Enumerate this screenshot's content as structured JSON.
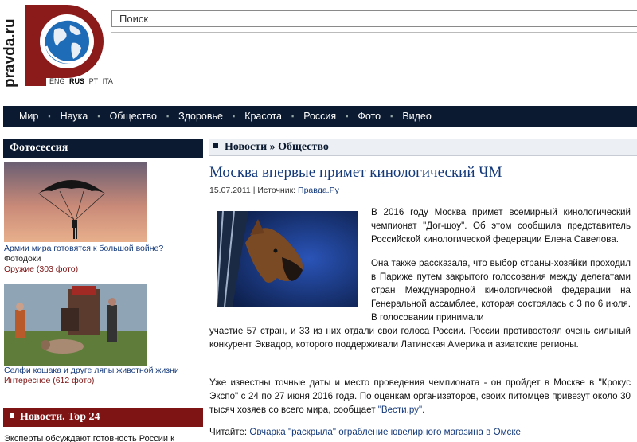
{
  "logo": {
    "wordmark": "pravda.ru",
    "brand_color": "#8b1a1a",
    "globe_color": "#1e6bb8"
  },
  "languages": [
    {
      "code": "ENG",
      "active": false
    },
    {
      "code": "RUS",
      "active": true
    },
    {
      "code": "PT",
      "active": false
    },
    {
      "code": "ITA",
      "active": false
    }
  ],
  "search": {
    "placeholder": "Поиск"
  },
  "nav": {
    "items": [
      "Мир",
      "Наука",
      "Общество",
      "Здоровье",
      "Красота",
      "Россия",
      "Фото",
      "Видео"
    ]
  },
  "sidebar": {
    "photo_section_title": "Фотосессия",
    "photos": [
      {
        "title": "Армии мира готовятся к большой войне?",
        "subtitle": "Фотодоки",
        "category": "Оружие (303 фото)"
      },
      {
        "title": "Селфи кошака и друге ляпы животной жизни",
        "subtitle": "",
        "category": "Интересное (612 фото)"
      }
    ],
    "news_section_title": "Новости. Top 24",
    "news_teaser": "Эксперты обсуждают готовность России к"
  },
  "main": {
    "breadcrumb": "Новости » Общество",
    "title": "Москва впервые примет кинологический ЧМ",
    "date": "15.07.2011",
    "source_label": "Источник:",
    "source_value": "Правда.Ру",
    "paragraphs": {
      "p1": "В 2016 году Москва примет всемирный кинологический чемпионат \"Дог-шоу\". Об этом сообщила представитель Российской кинологической федерации Елена Савелова.",
      "p2a": "Она также рассказала, что выбор страны-хозяйки проходил в Париже путем закрытого голосования между делегатами стран Международной кинологической федерации на Генеральной ассамблее, которая состоялась с 3 по 6 июля. В голосовании принимали",
      "p2b": "участие 57 стран, и 33 из них отдали свои голоса России.  России противостоял очень сильный конкурент Эквадор, которого поддерживали Латинская Америка и азиатские регионы.",
      "p3_pre": "Уже известны точные даты и место проведения чемпионата - он пройдет в Москве в \"Крокус Экспо\" с 24 по 27 июня 2016 года. По оценкам организаторов, своих питомцев привезут около 30 тысяч хозяев со всего мира, сообщает ",
      "p3_link": "\"Вести.ру\"",
      "p3_post": "."
    },
    "read_also_label": "Читайте:",
    "read_also_link": "Овчарка \"раскрыла\" ограбление ювелирного магазина в Омске"
  },
  "colors": {
    "nav_bg": "#0b1a30",
    "accent_red": "#7e1414",
    "link_blue": "#14397a"
  }
}
